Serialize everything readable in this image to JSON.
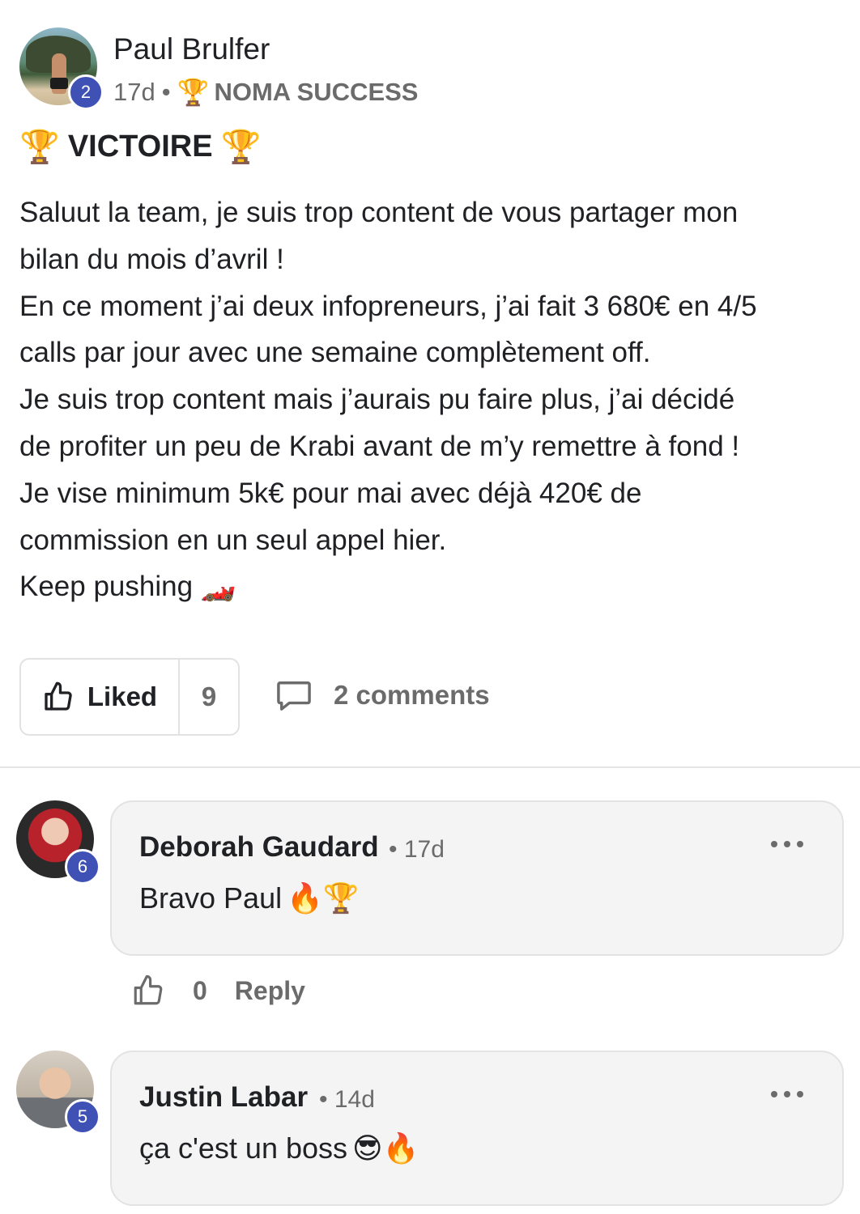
{
  "post": {
    "author": "Paul Brulfer",
    "author_level": "2",
    "age": "17d",
    "separator": "•",
    "category": "NOMA SUCCESS",
    "category_icon": "🏆",
    "title": "VICTOIRE",
    "title_icon": "🏆",
    "body_lines": [
      "Saluut la team, je suis trop content de vous partager mon",
      "bilan du mois d’avril !",
      "En ce moment j’ai deux infopreneurs, j’ai fait 3 680€ en 4/5",
      "calls par jour avec une semaine complètement off.",
      "Je suis trop content mais j’aurais pu faire plus, j’ai décidé",
      "de profiter un peu de Krabi avant de m’y remettre à fond !",
      "Je vise minimum 5k€ pour mai avec déjà 420€ de",
      "commission en un seul appel hier.",
      "Keep pushing 🏎️"
    ],
    "like_label": "Liked",
    "like_count": "9",
    "comments_label": "2 comments"
  },
  "comments": [
    {
      "author": "Deborah Gaudard",
      "level": "6",
      "separator": "•",
      "age": "17d",
      "text": "Bravo Paul",
      "emojis": "🔥🏆",
      "like_count": "0",
      "reply_label": "Reply"
    },
    {
      "author": "Justin Labar",
      "level": "5",
      "separator": "•",
      "age": "14d",
      "text": "ça c'est un boss",
      "emojis": "😎🔥"
    }
  ],
  "colors": {
    "level_badge": "#3f51b5",
    "muted_text": "#6b6b6b",
    "bubble_bg": "#f4f4f4"
  }
}
